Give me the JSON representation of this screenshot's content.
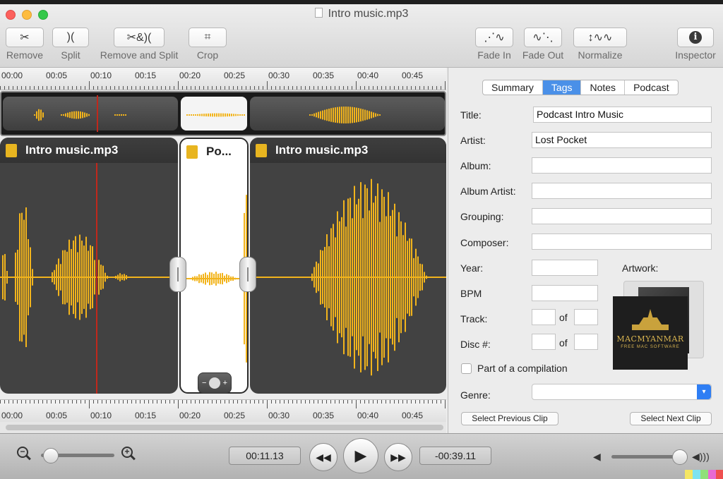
{
  "window": {
    "title": "Intro music.mp3"
  },
  "toolbar": {
    "remove": "Remove",
    "split": "Split",
    "remove_and_split": "Remove and Split",
    "crop": "Crop",
    "fade_in": "Fade In",
    "fade_out": "Fade Out",
    "normalize": "Normalize",
    "inspector": "Inspector"
  },
  "ruler": {
    "ticks": [
      "00:00",
      "00:05",
      "00:10",
      "00:15",
      "00:20",
      "00:25",
      "00:30",
      "00:35",
      "00:40",
      "00:45"
    ]
  },
  "clips": [
    {
      "name": "Intro music.mp3",
      "selected": false
    },
    {
      "name": "Po...",
      "selected": true
    },
    {
      "name": "Intro music.mp3",
      "selected": false
    }
  ],
  "inspector": {
    "tabs": [
      "Summary",
      "Tags",
      "Notes",
      "Podcast"
    ],
    "active_tab": "Tags",
    "fields": {
      "title_label": "Title:",
      "title_value": "Podcast Intro Music",
      "artist_label": "Artist:",
      "artist_value": "Lost Pocket",
      "album_label": "Album:",
      "album_value": "",
      "album_artist_label": "Album Artist:",
      "album_artist_value": "",
      "grouping_label": "Grouping:",
      "grouping_value": "",
      "composer_label": "Composer:",
      "composer_value": "",
      "year_label": "Year:",
      "year_value": "",
      "bpm_label": "BPM",
      "bpm_value": "",
      "track_label": "Track:",
      "disc_label": "Disc #:",
      "of_label": "of",
      "artwork_label": "Artwork:",
      "compilation_label": "Part of a compilation",
      "genre_label": "Genre:",
      "genre_value": ""
    },
    "prev_clip": "Select Previous Clip",
    "next_clip": "Select Next Clip"
  },
  "watermark": {
    "name": "MACMYANMAR",
    "tagline": "FREE MAC SOFTWARE"
  },
  "transport": {
    "current_time": "00:11.13",
    "remaining_time": "-00:39.11",
    "zoom_level": 0.05,
    "volume_level": 0.92
  },
  "colors": {
    "waveform": "#f2b41c",
    "playhead": "#c0281c",
    "tab_active": "#4a90e8"
  }
}
